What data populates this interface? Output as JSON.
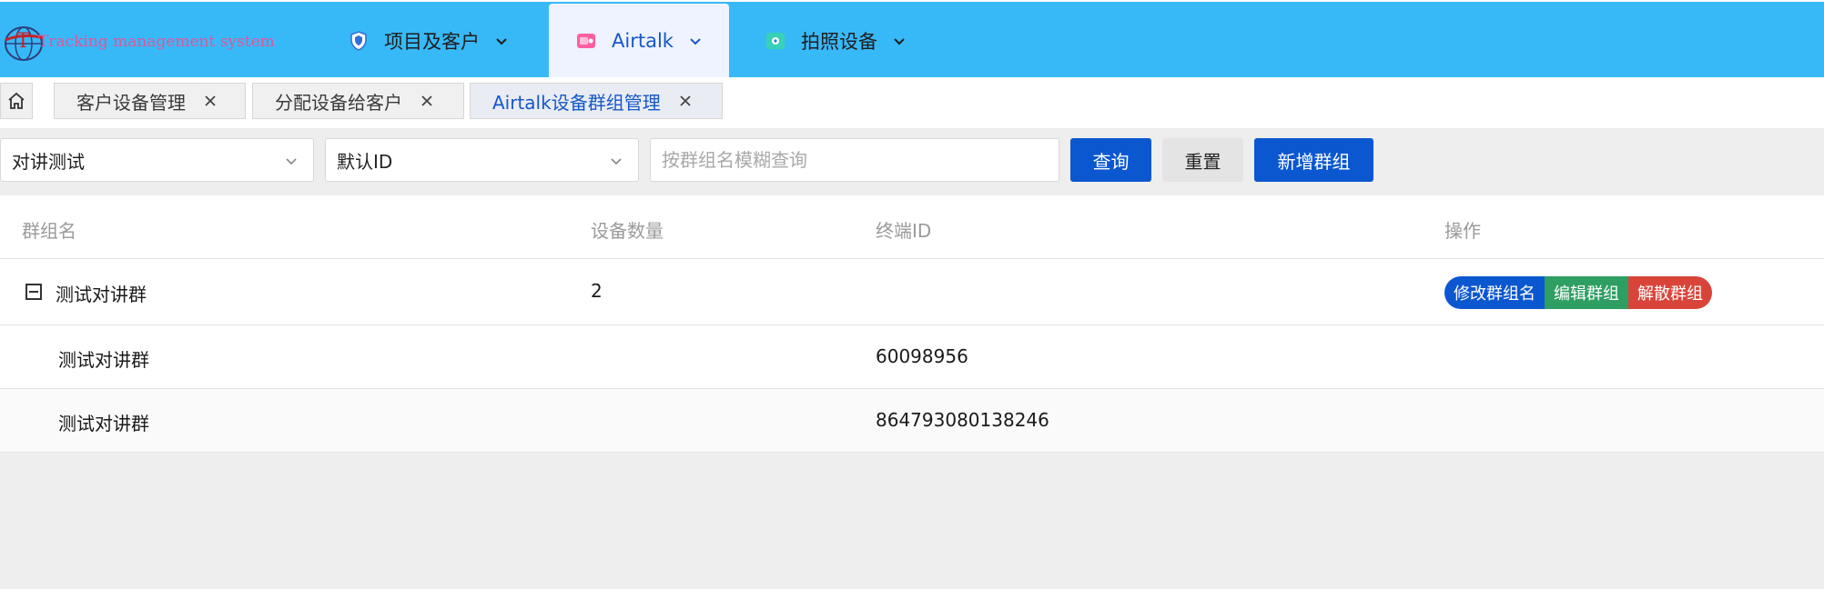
{
  "header": {
    "logo_text": "Tracking management system",
    "nav": [
      {
        "label": "项目及客户",
        "icon": "shield-icon"
      },
      {
        "label": "Airtalk",
        "icon": "airtalk-icon"
      },
      {
        "label": "拍照设备",
        "icon": "camera-device-icon"
      }
    ],
    "colors": {
      "bar": "#38b9f7",
      "active_text": "#1657c9"
    }
  },
  "tabs": [
    {
      "label": "客户设备管理"
    },
    {
      "label": "分配设备给客户"
    },
    {
      "label": "Airtalk设备群组管理"
    }
  ],
  "filters": {
    "project_select": "对讲测试",
    "id_select": "默认ID",
    "search_placeholder": "按群组名模糊查询",
    "query_label": "查询",
    "reset_label": "重置",
    "add_label": "新增群组"
  },
  "table": {
    "headers": [
      "群组名",
      "设备数量",
      "终端ID",
      "操作"
    ],
    "group": {
      "name": "测试对讲群",
      "count": "2",
      "actions": [
        "修改群组名",
        "编辑群组",
        "解散群组"
      ]
    },
    "children": [
      {
        "name": "测试对讲群",
        "terminal_id": "60098956"
      },
      {
        "name": "测试对讲群",
        "terminal_id": "864793080138246"
      }
    ]
  }
}
